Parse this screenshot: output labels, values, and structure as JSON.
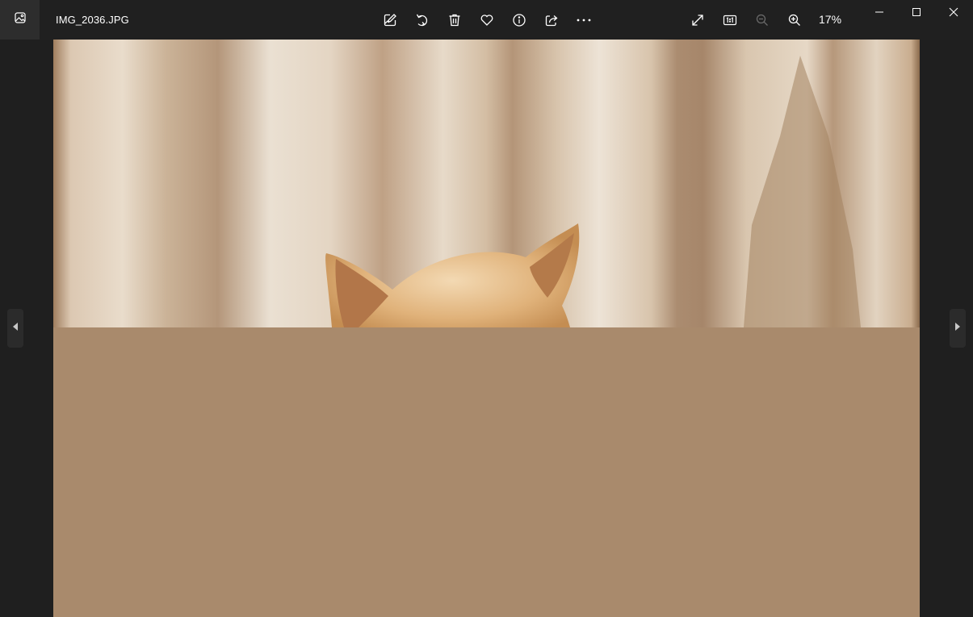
{
  "window": {
    "file_name": "IMG_2036.JPG"
  },
  "toolbar": {
    "items": [
      {
        "name": "edit-image",
        "icon": "edit-image-icon"
      },
      {
        "name": "rotate",
        "icon": "rotate-icon"
      },
      {
        "name": "delete",
        "icon": "trash-icon"
      },
      {
        "name": "favorite",
        "icon": "heart-icon"
      },
      {
        "name": "info",
        "icon": "info-icon"
      },
      {
        "name": "share",
        "icon": "share-icon"
      },
      {
        "name": "more",
        "icon": "more-icon"
      }
    ],
    "zoom_level": "17%"
  },
  "colors": {
    "titlebar": "#202020",
    "background": "#1f1f1f",
    "photo_fill": "#a98a6c"
  }
}
